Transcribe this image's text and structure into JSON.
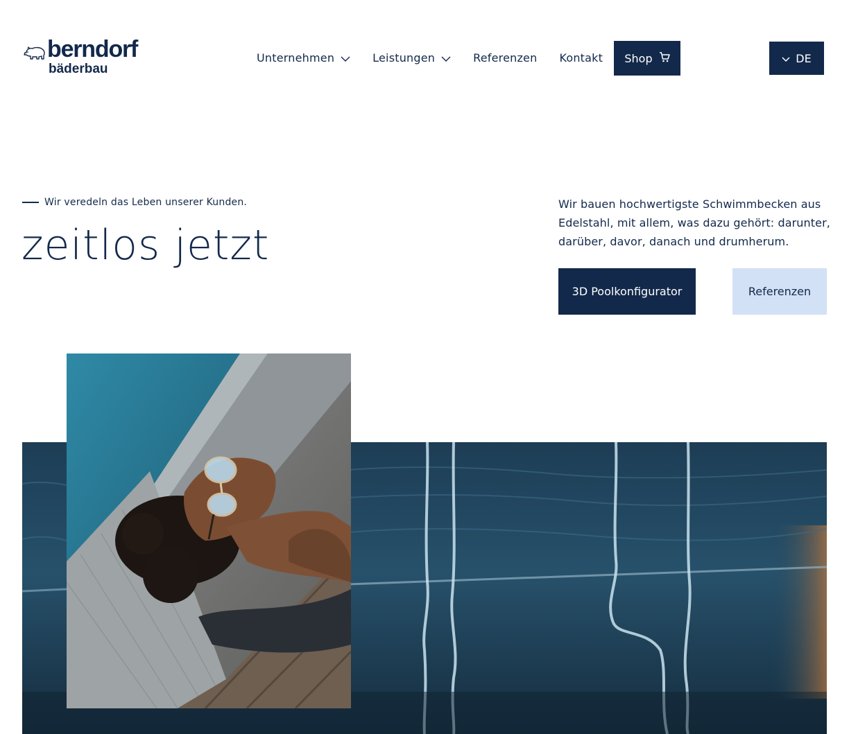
{
  "brand": {
    "name_line1": "berndorf",
    "name_line2": "bäderbau",
    "logo_icon": "bear-icon",
    "color_primary": "#13294b",
    "color_secondary_bg": "#d2e1f5"
  },
  "nav": {
    "items": [
      {
        "label": "Unternehmen",
        "has_dropdown": true
      },
      {
        "label": "Leistungen",
        "has_dropdown": true
      },
      {
        "label": "Referenzen",
        "has_dropdown": false
      },
      {
        "label": "Kontakt",
        "has_dropdown": false
      }
    ],
    "shop_label": "Shop",
    "shop_icon": "cart-icon",
    "language": "DE"
  },
  "hero": {
    "eyebrow": "Wir veredeln das Leben unserer Kunden.",
    "headline": "zeitlos jetzt",
    "intro": "Wir bauen hochwertigste Schwimmbecken aus Edelstahl, mit allem, was dazu gehört: darunter, darüber, davor, danach und drumherum.",
    "primary_button": "3D Poolkonfigurator",
    "secondary_button": "Referenzen"
  }
}
